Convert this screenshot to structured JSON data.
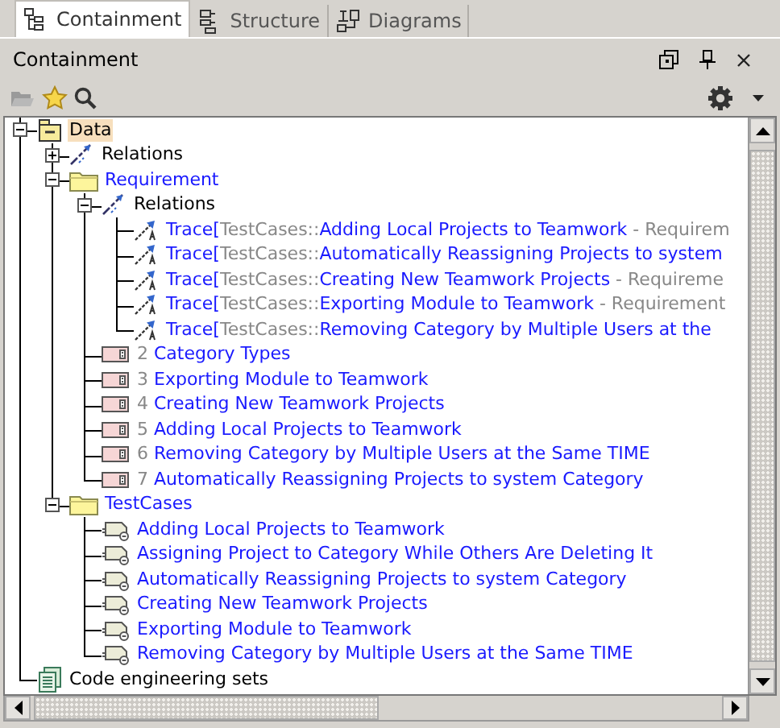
{
  "tabs": [
    {
      "label": "Containment",
      "kind": "containment",
      "selected": true
    },
    {
      "label": "Structure",
      "kind": "structure",
      "selected": false
    },
    {
      "label": "Diagrams",
      "kind": "diagrams",
      "selected": false
    }
  ],
  "panel": {
    "title": "Containment"
  },
  "toolbar": {
    "open_disabled": true
  },
  "tree": [
    {
      "kind": "package",
      "label": "Data",
      "selected": true,
      "expanded": true,
      "children": [
        {
          "kind": "relations",
          "label": "Relations",
          "selected": false,
          "expanded": false
        },
        {
          "kind": "folder",
          "label": "Requirement",
          "selected": false,
          "expanded": true,
          "children": [
            {
              "kind": "relations",
              "label": "Relations",
              "selected": false,
              "expanded": true,
              "children": [
                {
                  "kind": "trace",
                  "prefix": "Trace[",
                  "scope": "TestCases::",
                  "label": "Adding Local Projects to Teamwork",
                  "suffix": " - Requirem",
                  "selected": false
                },
                {
                  "kind": "trace",
                  "prefix": "Trace[",
                  "scope": "TestCases::",
                  "label": "Automatically Reassigning Projects to system",
                  "selected": false
                },
                {
                  "kind": "trace",
                  "prefix": "Trace[",
                  "scope": "TestCases::",
                  "label": "Creating New Teamwork Projects",
                  "suffix": " - Requireme",
                  "selected": false
                },
                {
                  "kind": "trace",
                  "prefix": "Trace[",
                  "scope": "TestCases::",
                  "label": "Exporting Module to Teamwork",
                  "suffix": " - Requirement",
                  "selected": false
                },
                {
                  "kind": "trace",
                  "prefix": "Trace[",
                  "scope": "TestCases::",
                  "label": "Removing Category by Multiple Users at the",
                  "selected": false
                }
              ]
            },
            {
              "kind": "requirement",
              "number": "2",
              "label": "Category Types",
              "selected": false
            },
            {
              "kind": "requirement",
              "number": "3",
              "label": "Exporting Module to Teamwork",
              "selected": false
            },
            {
              "kind": "requirement",
              "number": "4",
              "label": "Creating New Teamwork Projects",
              "selected": false
            },
            {
              "kind": "requirement",
              "number": "5",
              "label": "Adding Local Projects to Teamwork",
              "selected": false
            },
            {
              "kind": "requirement",
              "number": "6",
              "label": "Removing Category by Multiple Users at the Same TIME",
              "selected": false
            },
            {
              "kind": "requirement",
              "number": "7",
              "label": "Automatically Reassigning Projects to system Category",
              "selected": false
            }
          ]
        },
        {
          "kind": "folder",
          "label": "TestCases",
          "selected": false,
          "expanded": true,
          "children": [
            {
              "kind": "testcase",
              "label": "Adding Local Projects to Teamwork",
              "selected": false
            },
            {
              "kind": "testcase",
              "label": "Assigning Project to Category While Others Are Deleting It",
              "selected": false
            },
            {
              "kind": "testcase",
              "label": "Automatically Reassigning Projects to system Category",
              "selected": false
            },
            {
              "kind": "testcase",
              "label": "Creating New Teamwork Projects",
              "selected": false
            },
            {
              "kind": "testcase",
              "label": "Exporting Module to Teamwork",
              "selected": false
            },
            {
              "kind": "testcase",
              "label": "Removing Category by Multiple Users at the Same TIME",
              "selected": false
            }
          ]
        }
      ]
    },
    {
      "kind": "codesets",
      "label": "Code engineering sets",
      "selected": false
    }
  ]
}
